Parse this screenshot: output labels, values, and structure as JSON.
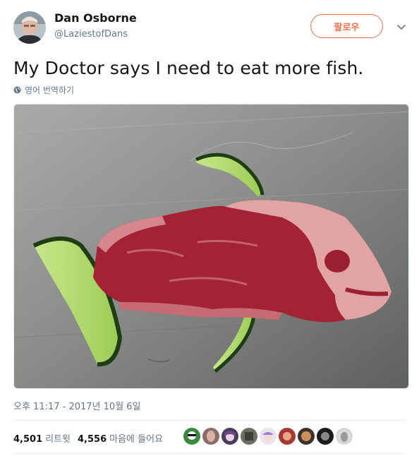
{
  "user": {
    "display_name": "Dan Osborne",
    "handle": "@LaziestofDans"
  },
  "follow_label": "팔로우",
  "tweet": {
    "text": "My Doctor says I need to eat more fish.",
    "translate_label": "영어 번역하기"
  },
  "timestamp": "오후 11:17 - 2017년 10월 6일",
  "stats": {
    "retweets_count": "4,501",
    "retweets_label": "리트윗",
    "likes_count": "4,556",
    "likes_label": "마음에 들어요"
  },
  "icons": {
    "caret": "chevron-down-icon",
    "globe": "globe-icon"
  },
  "colors": {
    "accent": "#f0704d",
    "secondary_text": "#657786",
    "divider": "#e6ecf0"
  }
}
